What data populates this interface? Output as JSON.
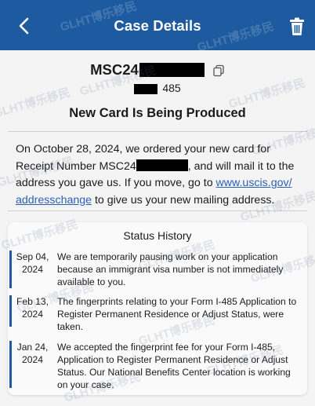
{
  "header": {
    "title": "Case Details",
    "back_icon": "chevron-left-icon",
    "delete_icon": "trash-icon",
    "bg_color": "#1d5a9f"
  },
  "case": {
    "receipt_prefix": "MSC24",
    "form_suffix": "485",
    "status": "New Card Is Being Produced"
  },
  "description": {
    "part1": "On October 28, 2024, we ordered your new card for Receipt Number MSC24",
    "part2": ", and will mail it to the address you gave us. If you move, go to ",
    "link1": "www.uscis.gov/",
    "link2": "addresschange",
    "part3": " to give us your new mailing address."
  },
  "history": {
    "title": "Status History",
    "entries": [
      {
        "date_line1": "Sep 04,",
        "date_line2": "2024",
        "text": "We are temporarily pausing work on your application because an immigrant visa number is not immediately available to you."
      },
      {
        "date_line1": "Feb 13,",
        "date_line2": "2024",
        "text": "The fingerprints relating to your Form I-485 Application to Register Permanent Residence or Adjust Status, were taken."
      },
      {
        "date_line1": "Jan 24,",
        "date_line2": "2024",
        "text": "We accepted the fingerprint fee for your Form I-485, Application to Register Permanent Residence or Adjust Status. Our National Benefits Center location is working on your case."
      }
    ]
  },
  "watermark_text": "GLHT博乐移民"
}
